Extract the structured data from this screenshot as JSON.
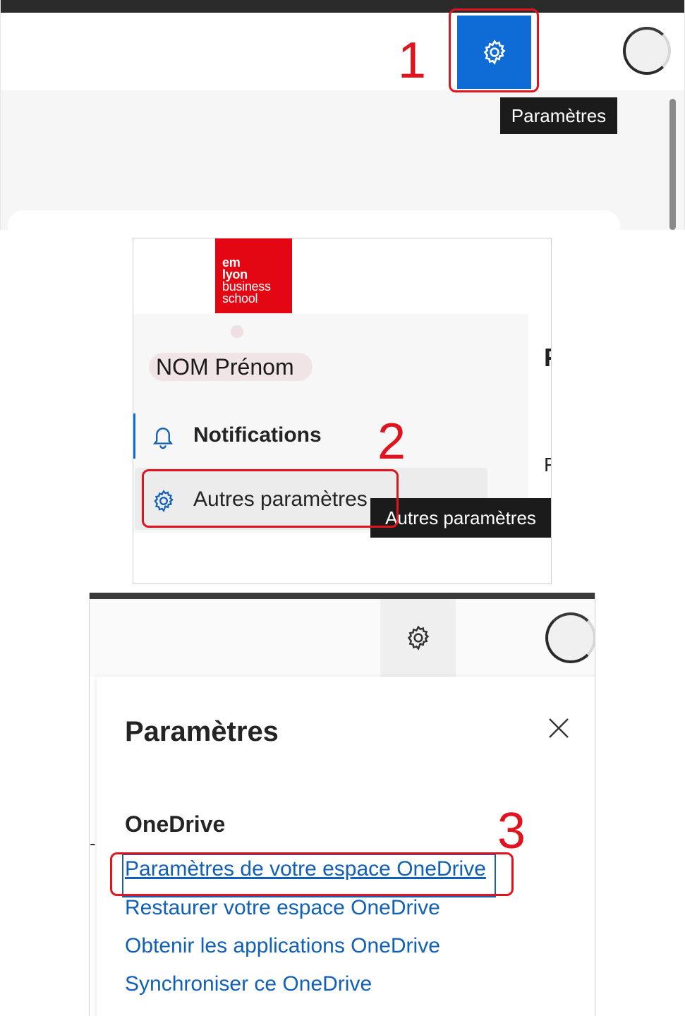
{
  "step1": {
    "number": "1",
    "tooltip": "Paramètres",
    "colors": {
      "accent": "#0f6cd6",
      "highlight": "#e0141e"
    }
  },
  "step2": {
    "number": "2",
    "logo_lines": [
      "em",
      "lyon",
      "business",
      "school"
    ],
    "user_name": "NOM Prénom",
    "menu": {
      "notifications_label": "Notifications",
      "other_settings_label": "Autres paramètres"
    },
    "tooltip": "Autres paramètres",
    "logo_color": "#e30613"
  },
  "step3": {
    "number": "3",
    "panel_title": "Paramètres",
    "section_title": "OneDrive",
    "links": [
      "Paramètres de votre espace OneDrive",
      "Restaurer votre espace OneDrive",
      "Obtenir les applications OneDrive",
      "Synchroniser ce OneDrive"
    ],
    "link_color": "#1160b7"
  }
}
